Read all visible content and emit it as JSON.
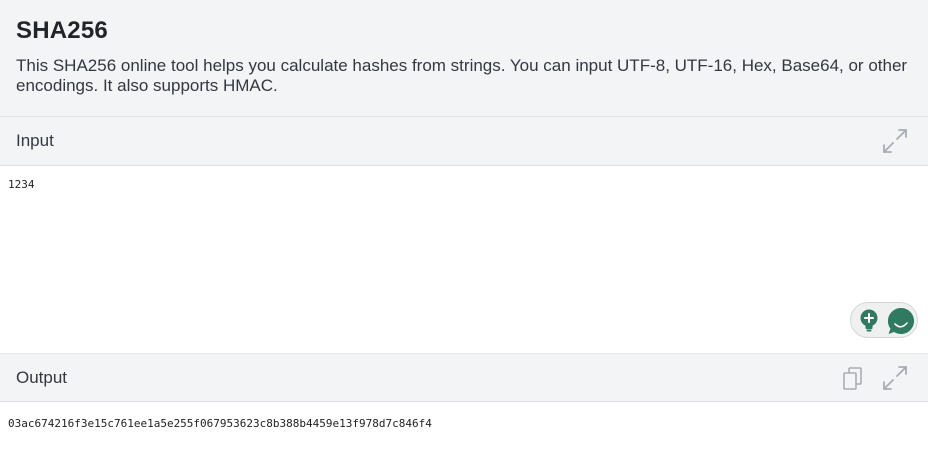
{
  "header": {
    "title": "SHA256",
    "description": "This SHA256 online tool helps you calculate hashes from strings. You can input UTF-8, UTF-16, Hex, Base64, or other encodings. It also supports HMAC."
  },
  "input": {
    "label": "Input",
    "value": "1234",
    "expand_icon": "expand-icon"
  },
  "output": {
    "label": "Output",
    "value": "03ac674216f3e15c761ee1a5e255f067953623c8b388b4459e13f978d7c846f4",
    "copy_icon": "copy-icon",
    "expand_icon": "expand-icon"
  },
  "widget": {
    "bulb_icon": "lightbulb-icon",
    "chat_icon": "chat-icon",
    "accent": "#2f7a60"
  },
  "colors": {
    "header_bg": "#f3f4f6",
    "text": "#212529",
    "icon": "#a7adb3"
  }
}
